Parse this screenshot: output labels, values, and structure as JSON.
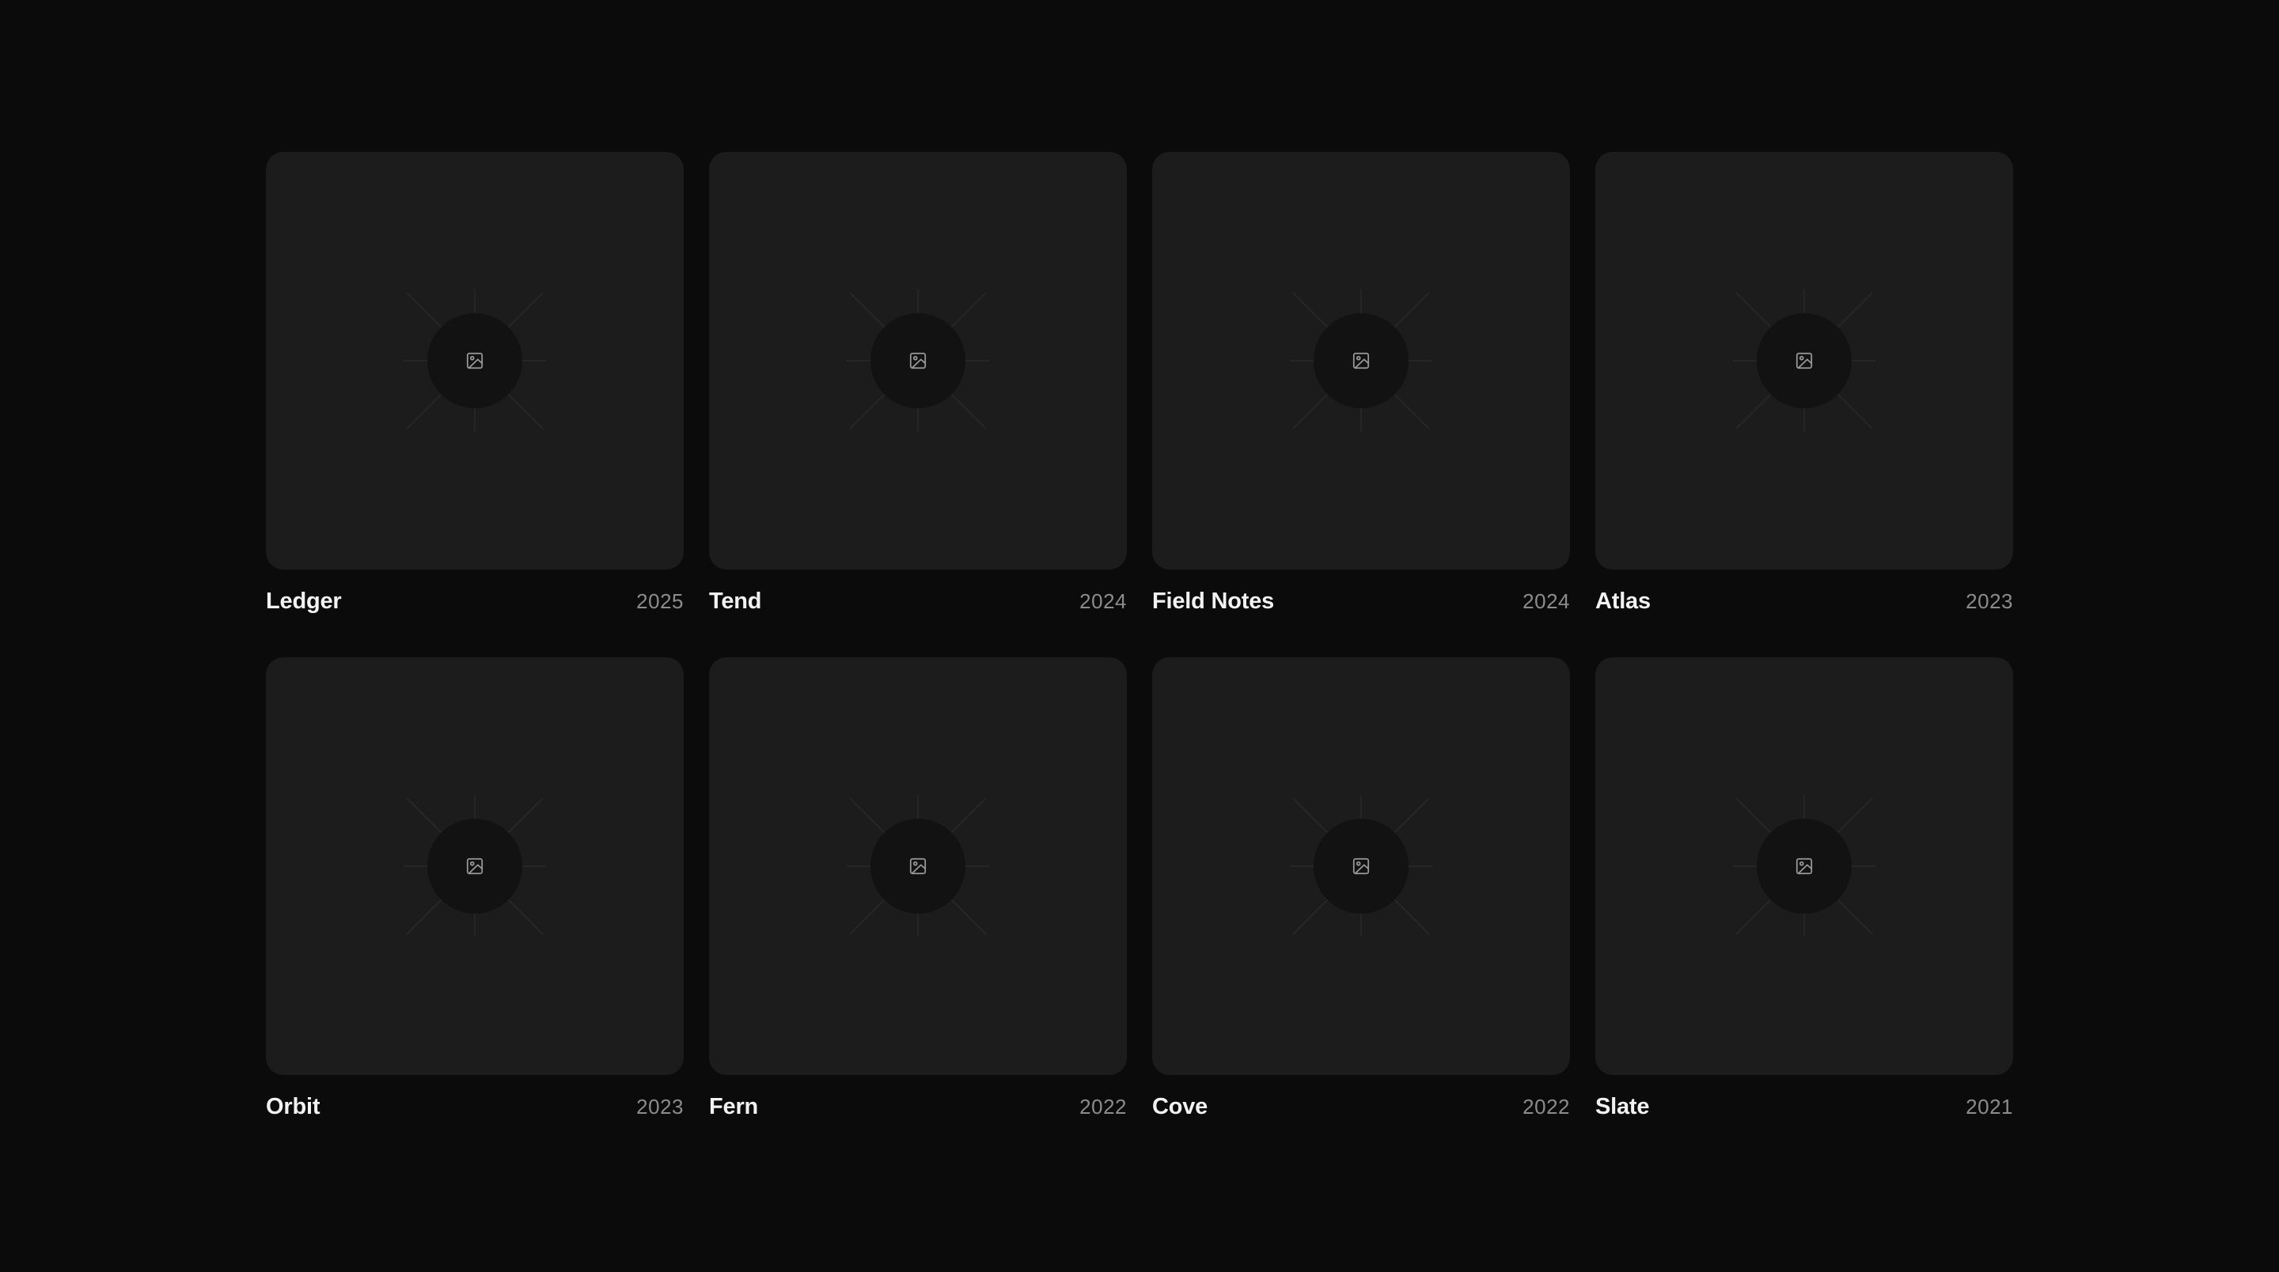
{
  "projects": [
    {
      "title": "Ledger",
      "year": "2025",
      "icon": "image-icon"
    },
    {
      "title": "Tend",
      "year": "2024",
      "icon": "image-icon"
    },
    {
      "title": "Field Notes",
      "year": "2024",
      "icon": "image-icon"
    },
    {
      "title": "Atlas",
      "year": "2023",
      "icon": "image-icon"
    },
    {
      "title": "Orbit",
      "year": "2023",
      "icon": "image-icon"
    },
    {
      "title": "Fern",
      "year": "2022",
      "icon": "image-icon"
    },
    {
      "title": "Cove",
      "year": "2022",
      "icon": "image-icon"
    },
    {
      "title": "Slate",
      "year": "2021",
      "icon": "image-icon"
    }
  ],
  "colors": {
    "background": "#0b0b0b",
    "card": "#1c1c1c",
    "icon_circle": "#121212",
    "title": "#f2f2f2",
    "year": "#8c8c8c"
  }
}
